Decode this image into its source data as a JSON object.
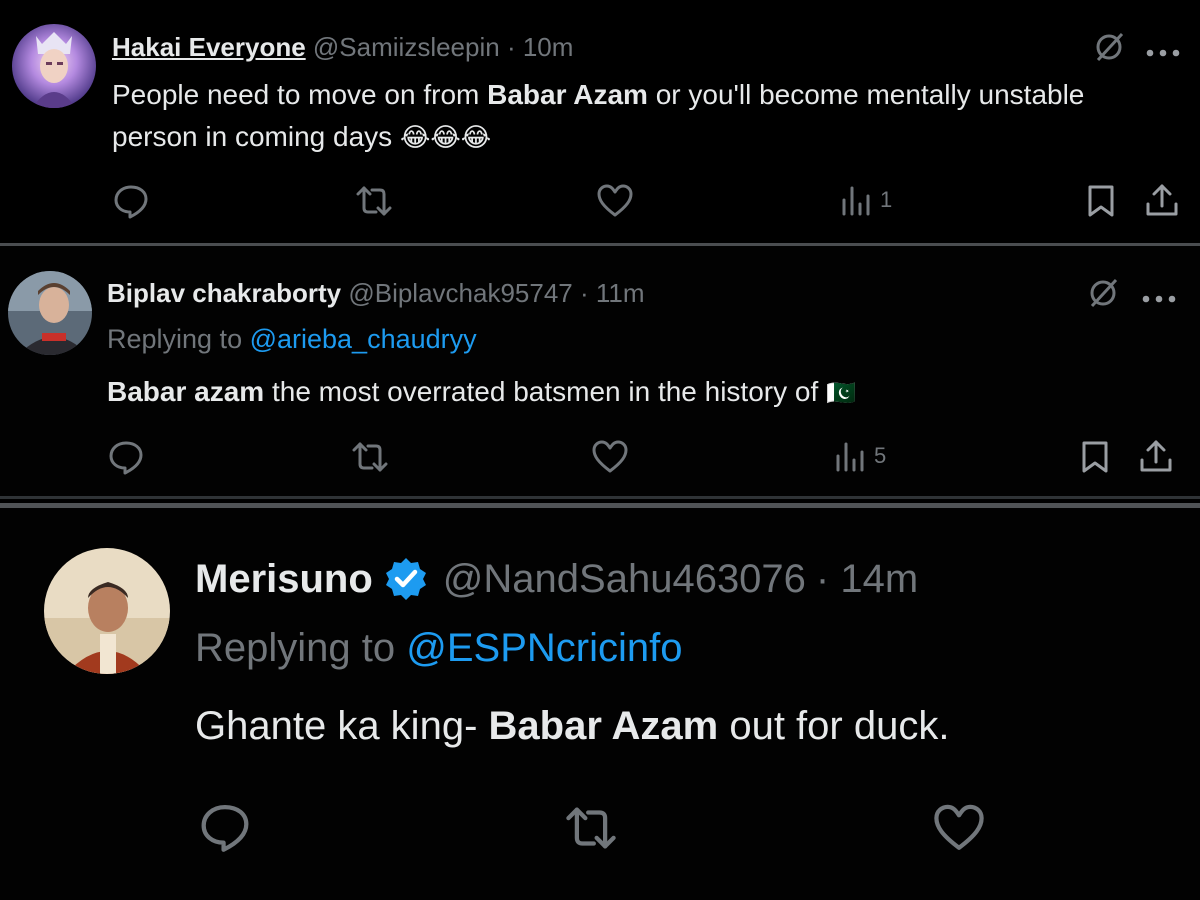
{
  "tweets": [
    {
      "name": "Hakai Everyone",
      "handle": "@Samiizsleepin",
      "time": "· 10m",
      "text_before": "People need to move on from ",
      "text_bold": "Babar Azam",
      "text_after": " or you'll become mentally unstable person in coming days ",
      "emoji": "😂😂😂",
      "views": "1"
    },
    {
      "name": "Biplav chakraborty",
      "handle": "@Biplavchak95747",
      "time": "· 11m",
      "replying_prefix": "Replying to ",
      "replying_to": "@arieba_chaudryy",
      "text_bold": "Babar azam",
      "text_after": " the most overrated batsmen in the history of",
      "flag": "🇵🇰",
      "views": "5"
    },
    {
      "name": "Merisuno",
      "handle": "@NandSahu463076",
      "time": "· 14m",
      "replying_prefix": "Replying to ",
      "replying_to": "@ESPNcricinfo",
      "text_before": "Ghante ka king- ",
      "text_bold": "Babar Azam",
      "text_after": " out for duck."
    }
  ],
  "colors": {
    "background": "#000000",
    "text": "#e7e9ea",
    "muted": "#71767b",
    "link": "#1d9bf0",
    "verified": "#1d9bf0"
  },
  "icons": [
    "reply-icon",
    "retweet-icon",
    "like-icon",
    "views-icon",
    "bookmark-icon",
    "share-icon",
    "grok-icon",
    "more-icon",
    "verified-badge-icon"
  ]
}
